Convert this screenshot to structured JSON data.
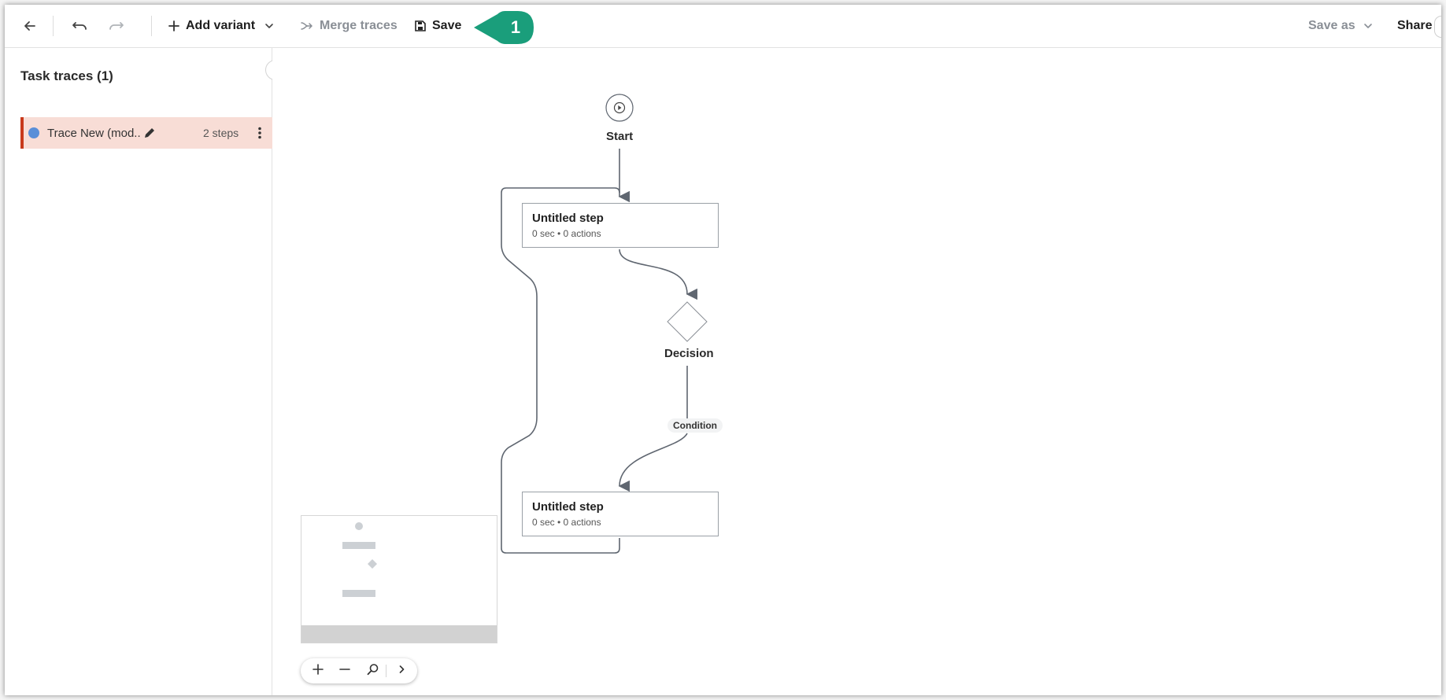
{
  "toolbar": {
    "add_variant_label": "Add variant",
    "merge_traces_label": "Merge traces",
    "save_label": "Save",
    "save_as_label": "Save as",
    "share_label": "Share",
    "callout_number": "1",
    "callout_color": "#1a9e7b"
  },
  "sidebar": {
    "title": "Task traces (1)",
    "traces": [
      {
        "name": "Trace New (mod...",
        "steps": "2 steps",
        "dot_color": "#5a8fd8"
      }
    ],
    "selected_color": "#f8ddd6",
    "accent_color": "#c8391b"
  },
  "flow": {
    "start_label": "Start",
    "steps": [
      {
        "title": "Untitled step",
        "subtitle": "0 sec • 0 actions"
      },
      {
        "title": "Untitled step",
        "subtitle": "0 sec • 0 actions"
      }
    ],
    "decision_label": "Decision",
    "condition_label": "Condition",
    "connector_color": "#5f6670"
  },
  "icons": {
    "back": "arrow-left-icon",
    "undo": "undo-icon",
    "redo": "redo-icon",
    "add": "plus-icon",
    "chevron": "chevron-down-icon",
    "merge": "merge-icon",
    "save": "floppy-disk-icon",
    "edit": "pencil-icon",
    "more": "kebab-menu-icon",
    "collapse": "chevron-left-icon",
    "play": "play-circle-icon",
    "zoom_in": "plus-icon",
    "zoom_out": "minus-icon",
    "fit": "zoom-fit-icon",
    "expand": "chevron-right-icon"
  }
}
